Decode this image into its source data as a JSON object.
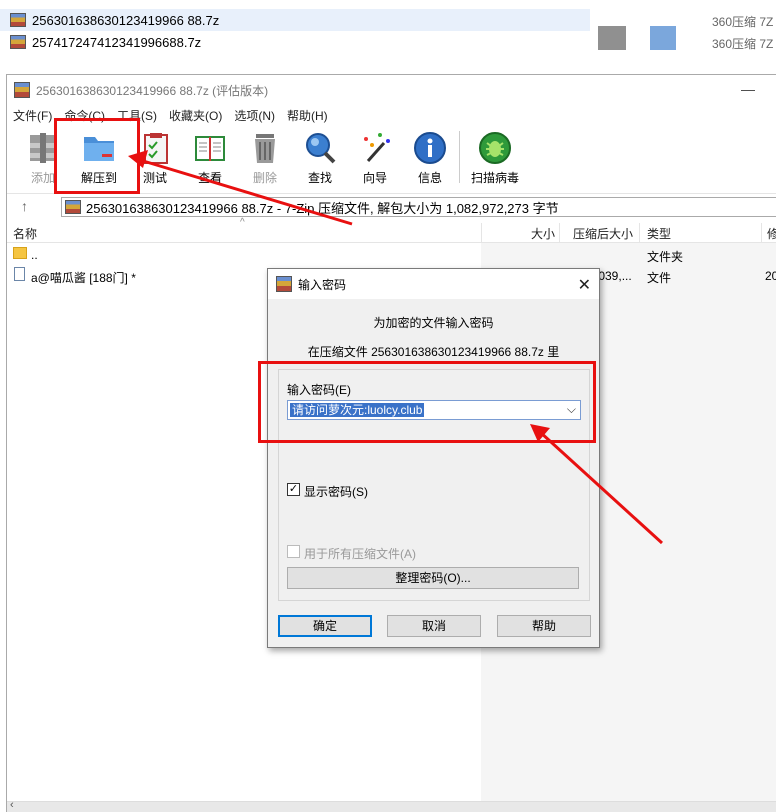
{
  "explorer": {
    "rows": [
      {
        "name": "256301638630123419966 88.7z",
        "type": "360压缩 7Z"
      },
      {
        "name": "257417247412341996688.7z",
        "type": "360压缩 7Z"
      }
    ]
  },
  "window": {
    "title": "256301638630123419966 88.7z (评估版本)",
    "menu": [
      "文件(F)",
      "命令(C)",
      "工具(S)",
      "收藏夹(O)",
      "选项(N)",
      "帮助(H)"
    ],
    "toolbar": [
      {
        "label": "添加",
        "icon": "add-archive-icon",
        "disabled": true
      },
      {
        "label": "解压到",
        "icon": "extract-folder-icon",
        "disabled": false
      },
      {
        "label": "测试",
        "icon": "test-clipboard-icon",
        "disabled": false
      },
      {
        "label": "查看",
        "icon": "view-book-icon",
        "disabled": false
      },
      {
        "label": "删除",
        "icon": "trash-icon",
        "disabled": true
      },
      {
        "label": "查找",
        "icon": "magnifier-icon",
        "disabled": false
      },
      {
        "label": "向导",
        "icon": "wizard-wand-icon",
        "disabled": false
      },
      {
        "label": "信息",
        "icon": "info-icon",
        "disabled": false
      },
      {
        "label": "扫描病毒",
        "icon": "virus-scan-icon",
        "disabled": false
      }
    ],
    "address": "256301638630123419966 88.7z - 7-Zip 压缩文件, 解包大小为 1,082,972,273 字节",
    "columns": {
      "name": "名称",
      "size": "大小",
      "packed": "压缩后大小",
      "type": "类型",
      "modified": "修"
    },
    "rows": [
      {
        "name": "..",
        "packed": "",
        "type": "文件夹",
        "modified": ""
      },
      {
        "name": "a@喵瓜酱 [188门] *",
        "packed": ",039,...",
        "type": "文件",
        "modified": "20"
      }
    ]
  },
  "dialog": {
    "title": "输入密码",
    "heading": "为加密的文件输入密码",
    "subheading": "在压缩文件 256301638630123419966 88.7z 里",
    "password_label": "输入密码(E)",
    "password_value": "请访问萝次元:luolcy.club",
    "show_password_label": "显示密码(S)",
    "show_password_checked": "✓",
    "all_archives_label": "用于所有压缩文件(A)",
    "organize_button": "整理密码(O)...",
    "ok_button": "确定",
    "cancel_button": "取消",
    "help_button": "帮助"
  },
  "colors": {
    "annotation": "#e81010",
    "selection": "#3a72c8",
    "default_button_border": "#0078d7"
  }
}
